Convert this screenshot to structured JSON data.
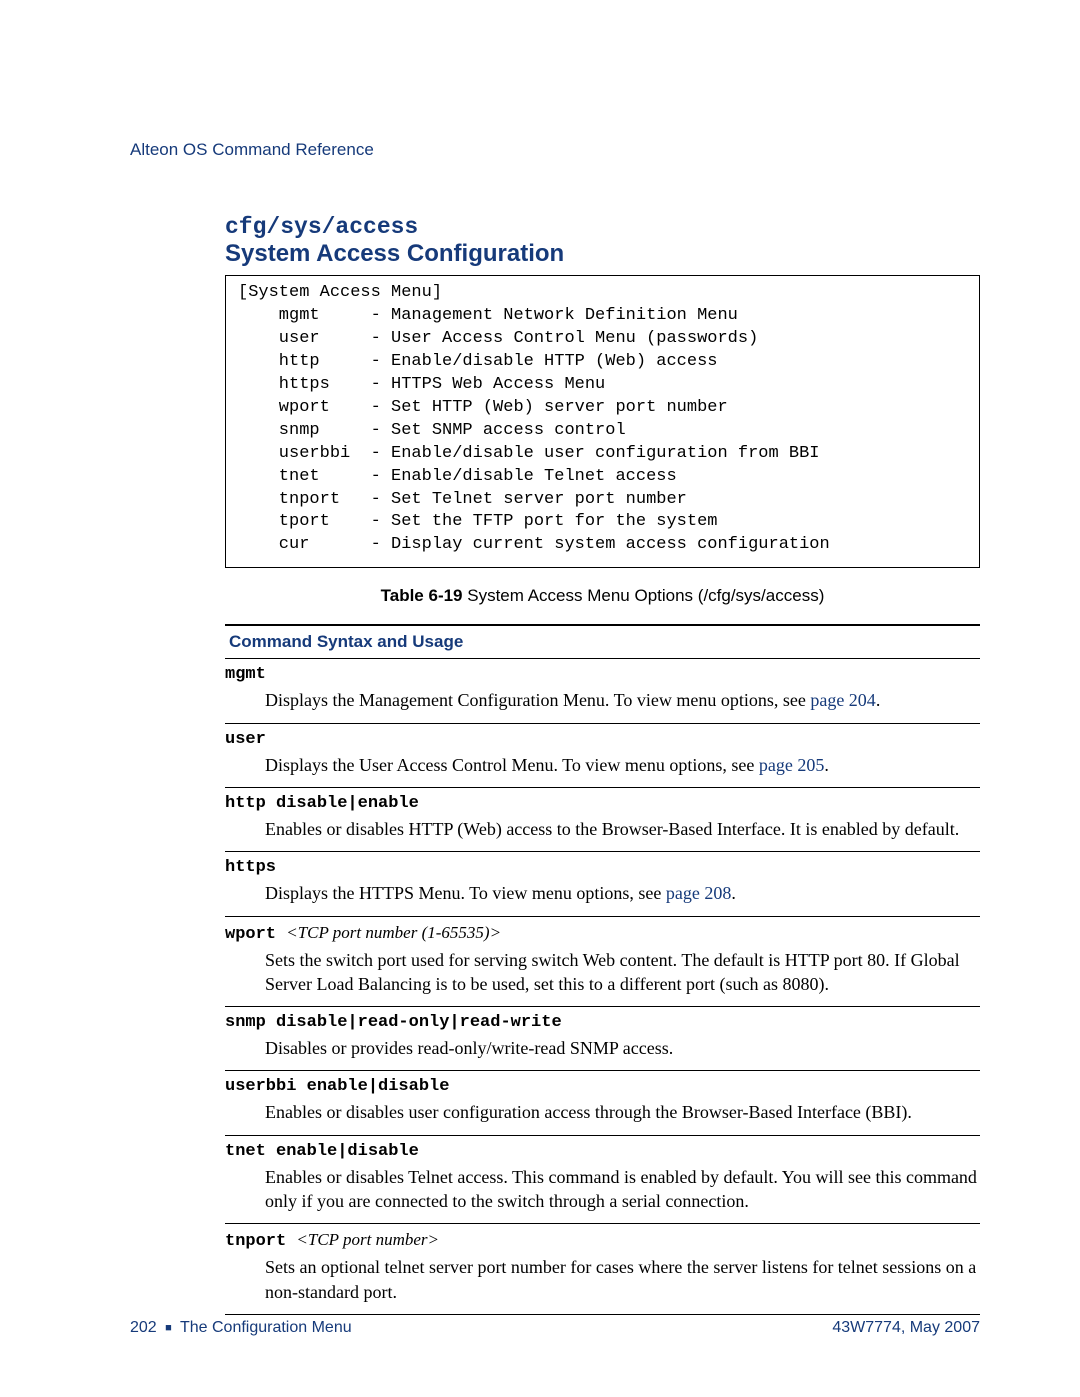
{
  "header": {
    "running_head": "Alteon OS Command Reference"
  },
  "section": {
    "code_heading": "cfg/sys/access",
    "title": "System Access Configuration"
  },
  "menu": {
    "title": "[System Access Menu]",
    "items": [
      {
        "cmd": "mgmt",
        "desc": "- Management Network Definition Menu"
      },
      {
        "cmd": "user",
        "desc": "- User Access Control Menu (passwords)"
      },
      {
        "cmd": "http",
        "desc": "- Enable/disable HTTP (Web) access"
      },
      {
        "cmd": "https",
        "desc": "- HTTPS Web Access Menu"
      },
      {
        "cmd": "wport",
        "desc": "- Set HTTP (Web) server port number"
      },
      {
        "cmd": "snmp",
        "desc": "- Set SNMP access control"
      },
      {
        "cmd": "userbbi",
        "desc": "- Enable/disable user configuration from BBI"
      },
      {
        "cmd": "tnet",
        "desc": "- Enable/disable Telnet access"
      },
      {
        "cmd": "tnport",
        "desc": "- Set Telnet server port number"
      },
      {
        "cmd": "tport",
        "desc": "- Set the TFTP port for the system"
      },
      {
        "cmd": "cur",
        "desc": "- Display current system access configuration"
      }
    ]
  },
  "table_caption": {
    "label": "Table 6-19",
    "text": "  System Access Menu Options (/cfg/sys/access)"
  },
  "column_header": "Command Syntax and Usage",
  "entries": [
    {
      "cmd": "mgmt",
      "arg": "",
      "desc_prefix": "Displays the Management Configuration Menu. To view menu options, see ",
      "link": "page 204",
      "desc_suffix": "."
    },
    {
      "cmd": "user",
      "arg": "",
      "desc_prefix": "Displays the User Access Control Menu. To view menu options, see ",
      "link": "page 205",
      "desc_suffix": "."
    },
    {
      "cmd": "http disable|enable",
      "arg": "",
      "desc_prefix": "Enables or disables HTTP (Web) access to the Browser-Based Interface. It is enabled by default.",
      "link": "",
      "desc_suffix": ""
    },
    {
      "cmd": "https",
      "arg": "",
      "desc_prefix": "Displays the HTTPS Menu. To view menu options, see ",
      "link": "page 208",
      "desc_suffix": "."
    },
    {
      "cmd": "wport ",
      "arg": "<TCP port number (1-65535)>",
      "desc_prefix": "Sets the switch port used for serving switch Web content. The default is HTTP port 80. If Global Server Load Balancing is to be used, set this to a different port (such as 8080).",
      "link": "",
      "desc_suffix": ""
    },
    {
      "cmd": "snmp disable|read-only|read-write",
      "arg": "",
      "desc_prefix": "Disables or provides read-only/write-read SNMP access.",
      "link": "",
      "desc_suffix": ""
    },
    {
      "cmd": "userbbi enable|disable",
      "arg": "",
      "desc_prefix": "Enables or disables user configuration access through the Browser-Based Interface (BBI).",
      "link": "",
      "desc_suffix": ""
    },
    {
      "cmd": "tnet enable|disable",
      "arg": "",
      "desc_prefix": "Enables or disables Telnet access. This command is enabled by default. You will see this command only if you are connected to the switch through a serial connection.",
      "link": "",
      "desc_suffix": ""
    },
    {
      "cmd": "tnport  ",
      "arg": "<TCP port number>",
      "desc_prefix": "Sets an optional telnet server port number for cases where the server listens for telnet sessions on a non-standard port.",
      "link": "",
      "desc_suffix": ""
    }
  ],
  "footer": {
    "page_number": "202",
    "chapter": "The Configuration Menu",
    "doc_id": "43W7774, May 2007"
  }
}
